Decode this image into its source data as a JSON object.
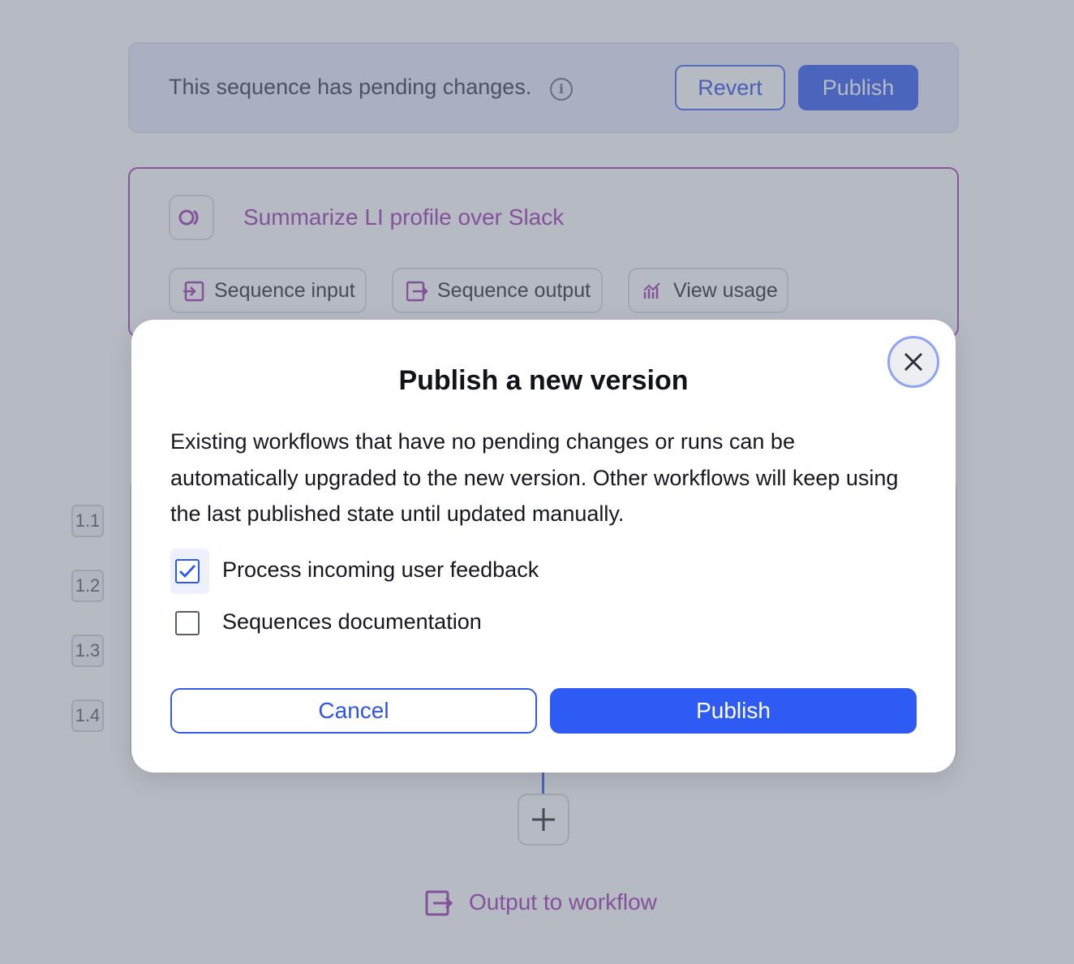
{
  "banner": {
    "message": "This sequence has pending changes.",
    "revert_label": "Revert",
    "publish_label": "Publish"
  },
  "sequence": {
    "title": "Summarize LI profile over Slack",
    "buttons": {
      "input_label": "Sequence input",
      "output_label": "Sequence output",
      "usage_label": "View usage"
    }
  },
  "steps": [
    "1.1",
    "1.2",
    "1.3",
    "1.4"
  ],
  "output_link_label": "Output to workflow",
  "modal": {
    "title": "Publish a new version",
    "body": "Existing workflows that have no pending changes or runs can be automatically upgraded to the new version. Other workflows will keep using the last published state until updated manually.",
    "workflows": [
      {
        "label": "Process incoming user feedback",
        "checked": true
      },
      {
        "label": "Sequences documentation",
        "checked": false
      }
    ],
    "cancel_label": "Cancel",
    "publish_label": "Publish"
  },
  "colors": {
    "accent": "#2f5bf5",
    "sequence_purple": "#a23fb3",
    "overlay": "rgba(95,104,125,0.46)"
  }
}
